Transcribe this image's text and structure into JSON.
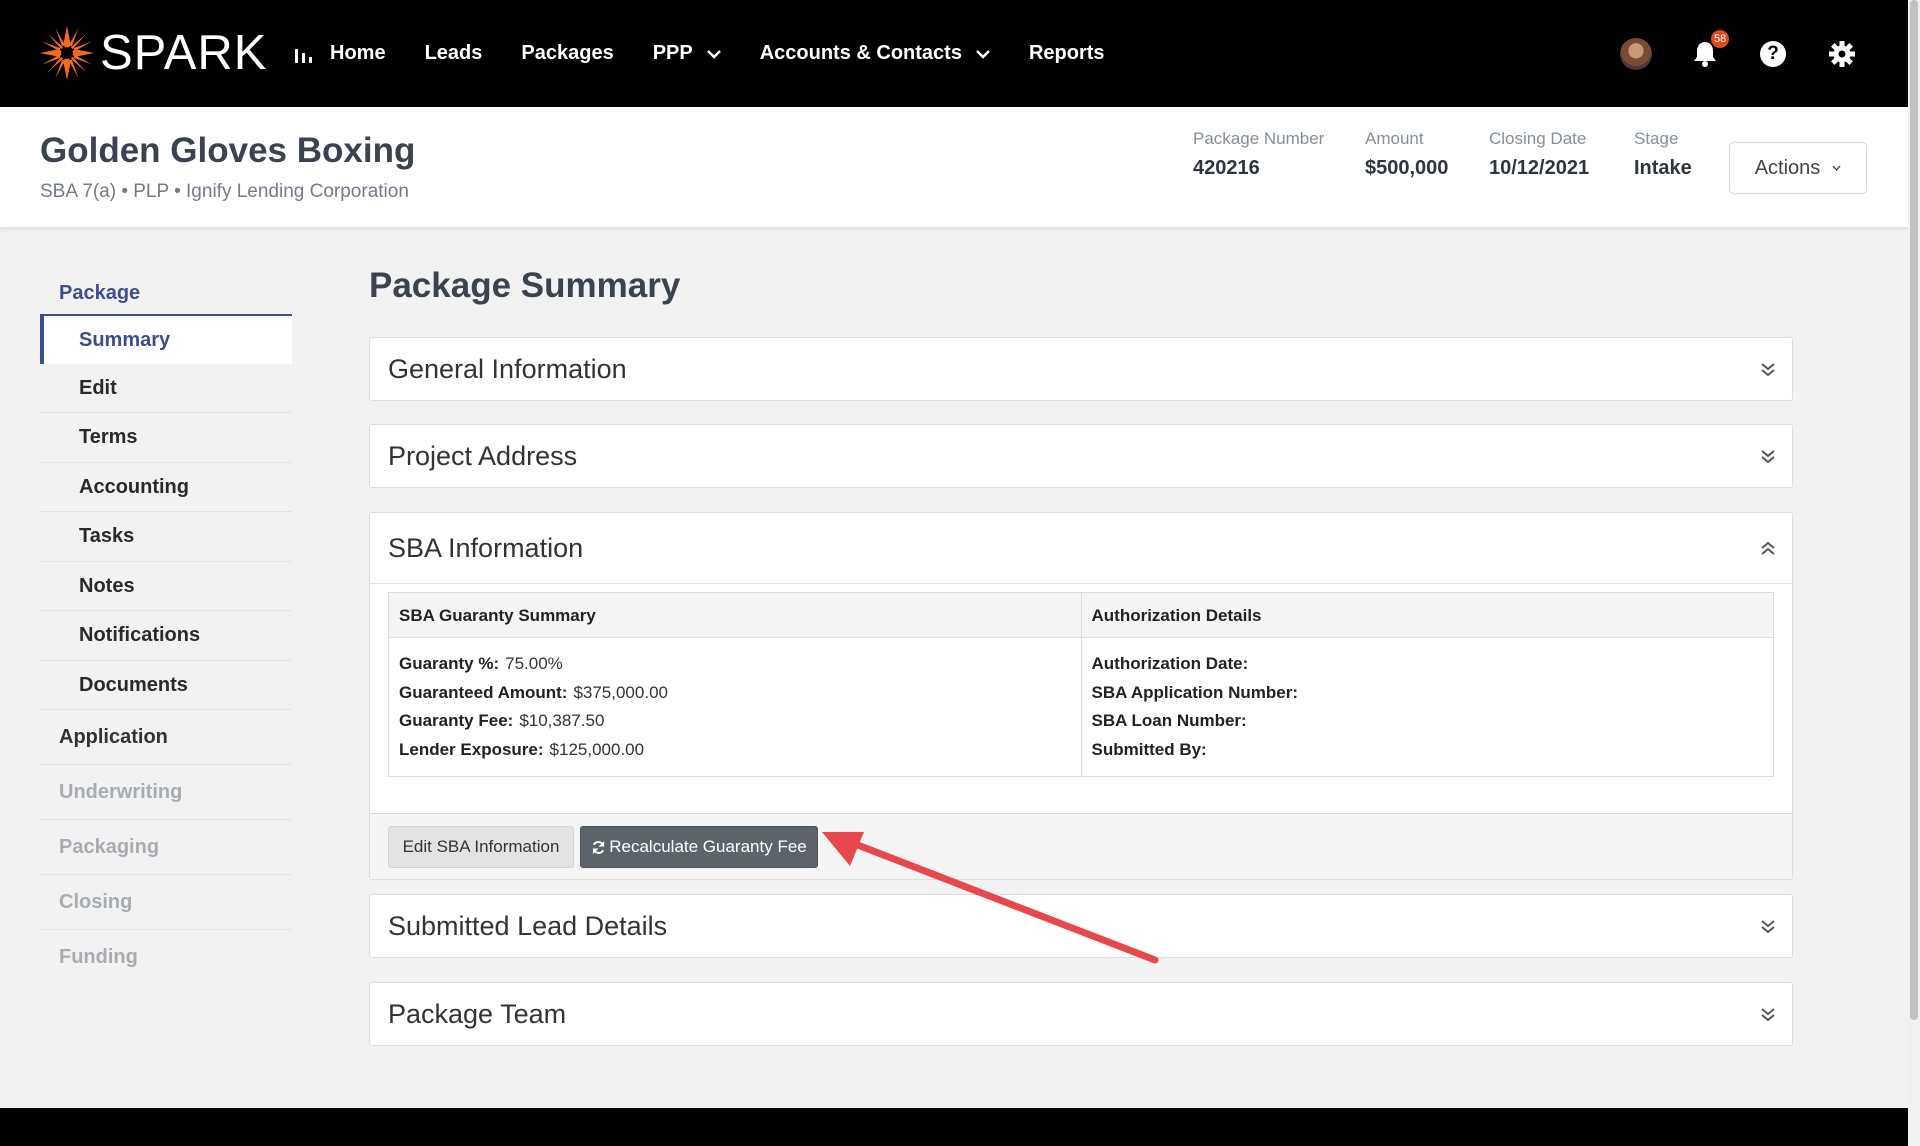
{
  "brand": {
    "name": "SPARK",
    "accent": "#f26a21"
  },
  "nav": {
    "home": "Home",
    "leads": "Leads",
    "packages": "Packages",
    "ppp": "PPP",
    "accounts": "Accounts & Contacts",
    "reports": "Reports",
    "notification_count": "58",
    "help_glyph": "?"
  },
  "header": {
    "title": "Golden Gloves Boxing",
    "subtitle": "SBA 7(a) • PLP • Ignify Lending Corporation",
    "meta": [
      {
        "label": "Package Number",
        "value": "420216"
      },
      {
        "label": "Amount",
        "value": "$500,000"
      },
      {
        "label": "Closing Date",
        "value": "10/12/2021"
      },
      {
        "label": "Stage",
        "value": "Intake"
      }
    ],
    "actions_label": "Actions"
  },
  "sidebar": {
    "package_label": "Package",
    "items": [
      "Summary",
      "Edit",
      "Terms",
      "Accounting",
      "Tasks",
      "Notes",
      "Notifications",
      "Documents"
    ],
    "application": "Application",
    "underwriting": "Underwriting",
    "packaging": "Packaging",
    "closing": "Closing",
    "funding": "Funding"
  },
  "main": {
    "title": "Package Summary",
    "panels": {
      "general": "General Information",
      "address": "Project Address",
      "sba": "SBA Information",
      "lead": "Submitted Lead Details",
      "team": "Package Team"
    },
    "sba": {
      "guaranty_head": "SBA Guaranty Summary",
      "auth_head": "Authorization Details",
      "guaranty_rows": [
        {
          "label": "Guaranty %:",
          "value": "75.00%"
        },
        {
          "label": "Guaranteed Amount:",
          "value": "$375,000.00"
        },
        {
          "label": "Guaranty Fee:",
          "value": "$10,387.50"
        },
        {
          "label": "Lender Exposure:",
          "value": "$125,000.00"
        }
      ],
      "auth_rows": [
        {
          "label": "Authorization Date:",
          "value": ""
        },
        {
          "label": "SBA Application Number:",
          "value": ""
        },
        {
          "label": "SBA Loan Number:",
          "value": ""
        },
        {
          "label": "Submitted By:",
          "value": ""
        }
      ],
      "edit_button": "Edit SBA Information",
      "recalc_button": "Recalculate Guaranty Fee"
    }
  },
  "annotation": {
    "arrow_color": "#e8474b"
  }
}
